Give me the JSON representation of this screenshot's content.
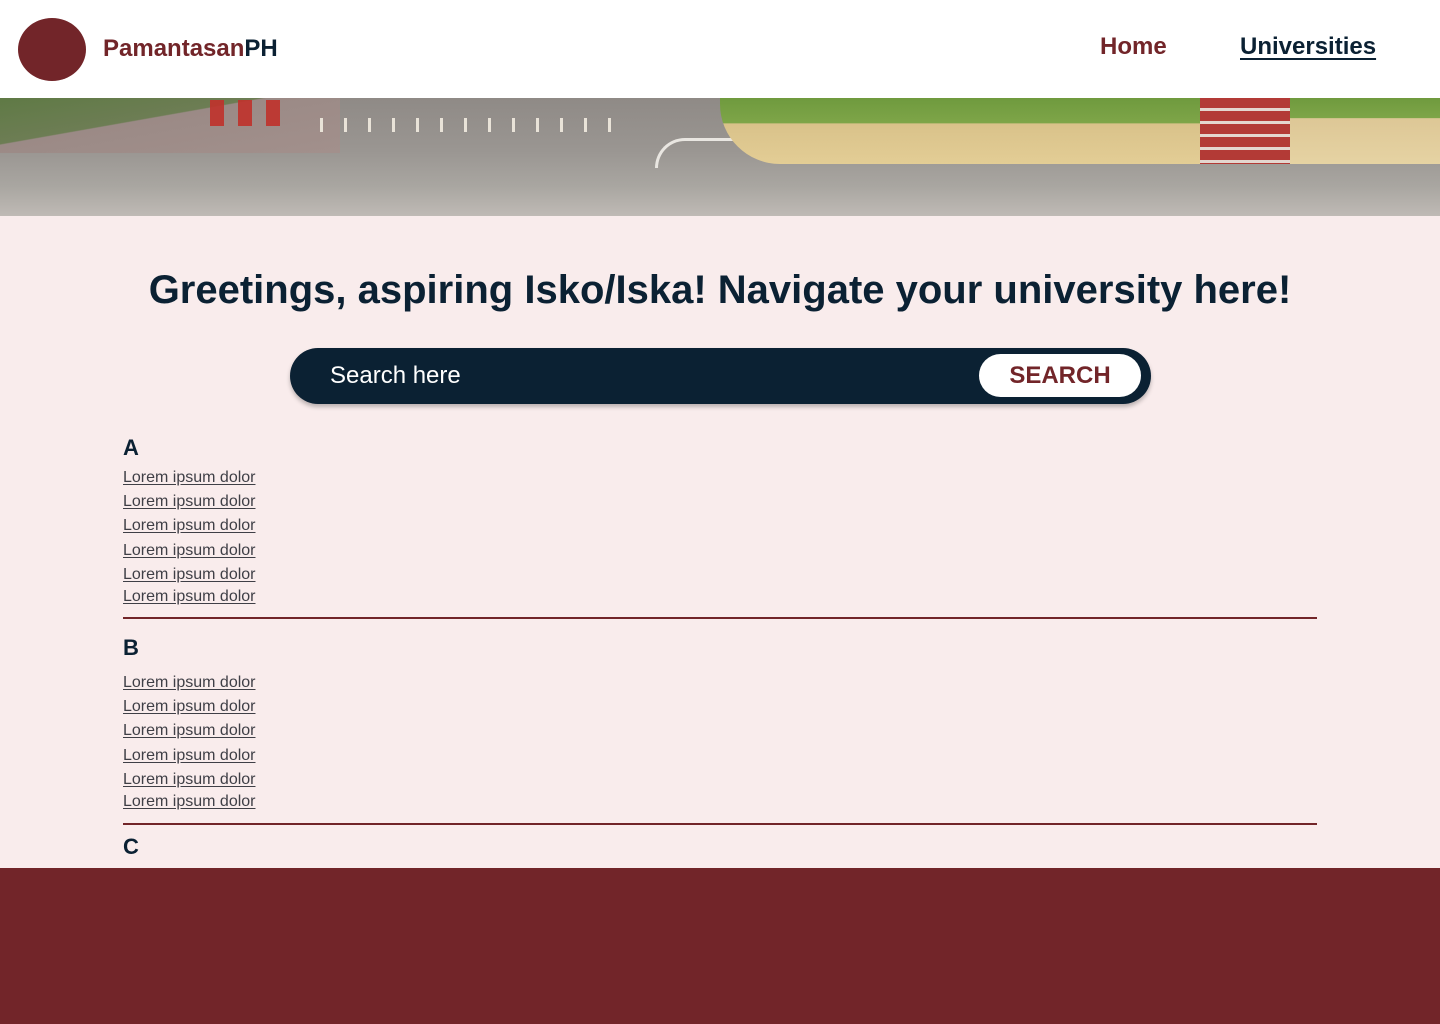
{
  "header": {
    "brand_part1": "Pamantasan",
    "brand_part2": "PH",
    "nav": [
      {
        "label": "Home",
        "active": false
      },
      {
        "label": "Universities",
        "active": true
      }
    ]
  },
  "hero": {
    "image": "campus-photo"
  },
  "greeting": "Greetings, aspiring Isko/Iska! Navigate your university here!",
  "search": {
    "placeholder": "Search here",
    "button_label": "SEARCH"
  },
  "directory": [
    {
      "letter": "A",
      "links": [
        "Lorem ipsum dolor",
        "Lorem ipsum dolor",
        "Lorem ipsum dolor",
        "Lorem ipsum dolor",
        "Lorem ipsum dolor",
        "Lorem ipsum dolor"
      ]
    },
    {
      "letter": "B",
      "links": [
        "Lorem ipsum dolor",
        "Lorem ipsum dolor",
        "Lorem ipsum dolor",
        "Lorem ipsum dolor",
        "Lorem ipsum dolor",
        "Lorem ipsum dolor"
      ]
    },
    {
      "letter": "C",
      "links": []
    }
  ],
  "colors": {
    "primary": "#722529",
    "navy": "#0b2133",
    "background": "#f9ecec",
    "footer": "#722529"
  }
}
